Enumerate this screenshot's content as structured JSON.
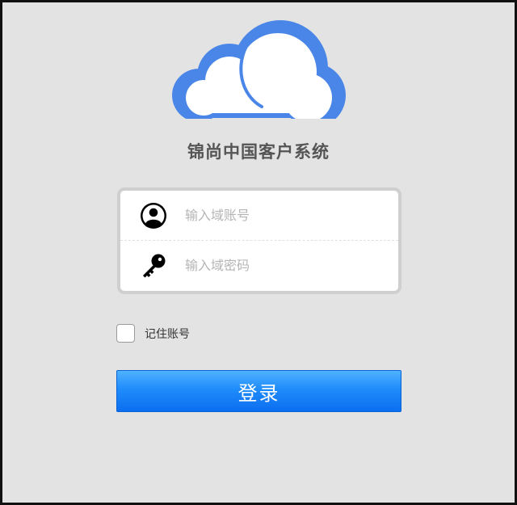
{
  "brand": {
    "logo_icon": "cloud-icon",
    "title": "锦尚中国客户系统",
    "accent_color": "#4a86e8"
  },
  "login": {
    "username": {
      "icon": "user-icon",
      "placeholder": "输入域账号",
      "value": ""
    },
    "password": {
      "icon": "key-icon",
      "placeholder": "输入域密码",
      "value": ""
    }
  },
  "remember": {
    "label": "记住账号",
    "checked": false
  },
  "actions": {
    "login_label": "登录",
    "button_color": "#1f8cfb"
  }
}
